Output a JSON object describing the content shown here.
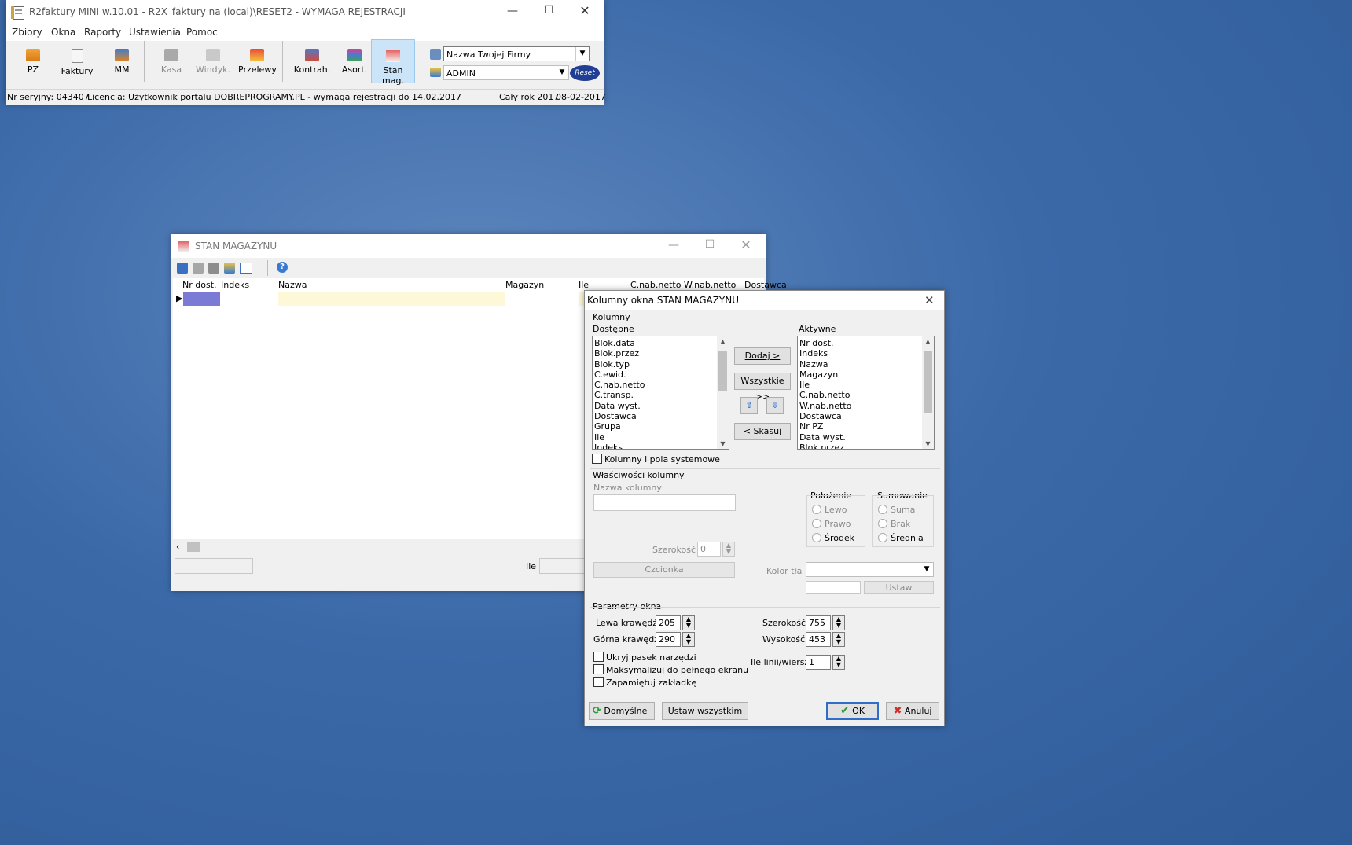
{
  "main_window": {
    "title": "R2faktury MINI w.10.01 - R2X_faktury na (local)\\RESET2 - WYMAGA REJESTRACJI",
    "menu": [
      "Zbiory",
      "Okna",
      "Raporty",
      "Ustawienia",
      "Pomoc"
    ],
    "toolbar": {
      "pz": "PZ",
      "faktury": "Faktury",
      "mm": "MM",
      "kasa": "Kasa",
      "windyk": "Windyk.",
      "przelewy": "Przelewy",
      "kontrah": "Kontrah.",
      "asort": "Asort.",
      "stan_mag": "Stan mag."
    },
    "company_combo": "Nazwa Twojej Firmy",
    "user_combo": "ADMIN",
    "logo_text": "Reset",
    "status": {
      "serial": "Nr seryjny: 043407",
      "license": "Licencja: Użytkownik portalu DOBREPROGRAMY.PL - wymaga rejestracji do 14.02.2017",
      "period": "Cały rok 2017",
      "date": "08-02-2017"
    }
  },
  "stan_window": {
    "title": "STAN MAGAZYNU",
    "columns": [
      "Nr dost.",
      "Indeks",
      "Nazwa",
      "Magazyn",
      "Ile",
      "C.nab.netto",
      "W.nab.netto",
      "Dostawca"
    ],
    "footer_label": "Ile"
  },
  "dialog": {
    "title": "Kolumny okna STAN MAGAZYNU",
    "kolumny_group": "Kolumny",
    "dostepne_label": "Dostępne",
    "aktywne_label": "Aktywne",
    "dostepne": [
      "Blok.data",
      "Blok.przez",
      "Blok.typ",
      "C.ewid.",
      "C.nab.netto",
      "C.transp.",
      "Data wyst.",
      "Dostawca",
      "Grupa",
      "Ile",
      "Indeks"
    ],
    "aktywne": [
      "Nr dost.",
      "Indeks",
      "Nazwa",
      "Magazyn",
      "Ile",
      "C.nab.netto",
      "W.nab.netto",
      "Dostawca",
      "Nr PZ",
      "Data wyst.",
      "Blok.przez"
    ],
    "btn_dodaj": "Dodaj >",
    "btn_wszystkie": "Wszystkie >>",
    "btn_skasuj": "< Skasuj",
    "chk_systemowe": "Kolumny i pola systemowe",
    "wlasciwosci_group": "Właściwości kolumny",
    "nazwa_kolumny_label": "Nazwa kolumny",
    "szerokosc_label": "Szerokość",
    "szerokosc_value": "0",
    "czcionka_btn": "Czcionka",
    "kolor_tla_label": "Kolor tła",
    "ustaw_btn": "Ustaw",
    "polozenie_group": "Położenie",
    "polozenie_opts": [
      "Lewo",
      "Prawo",
      "Środek"
    ],
    "sumowanie_group": "Sumowanie",
    "sumowanie_opts": [
      "Suma",
      "Brak",
      "Średnia"
    ],
    "parametry_group": "Parametry okna",
    "lewa_label": "Lewa krawędź",
    "lewa_value": "205",
    "gorna_label": "Górna krawędź",
    "gorna_value": "290",
    "szer_label": "Szerokość",
    "szer_value": "755",
    "wys_label": "Wysokość",
    "wys_value": "453",
    "ile_linii_label": "Ile linii/wiersz",
    "ile_linii_value": "1",
    "chk_ukryj": "Ukryj pasek narzędzi",
    "chk_maks": "Maksymalizuj do pełnego ekranu",
    "chk_zapamietuj": "Zapamiętuj zakładkę",
    "btn_domyslne": "Domyślne",
    "btn_ustaw_wszystkim": "Ustaw wszystkim",
    "btn_ok": "OK",
    "btn_anuluj": "Anuluj"
  }
}
